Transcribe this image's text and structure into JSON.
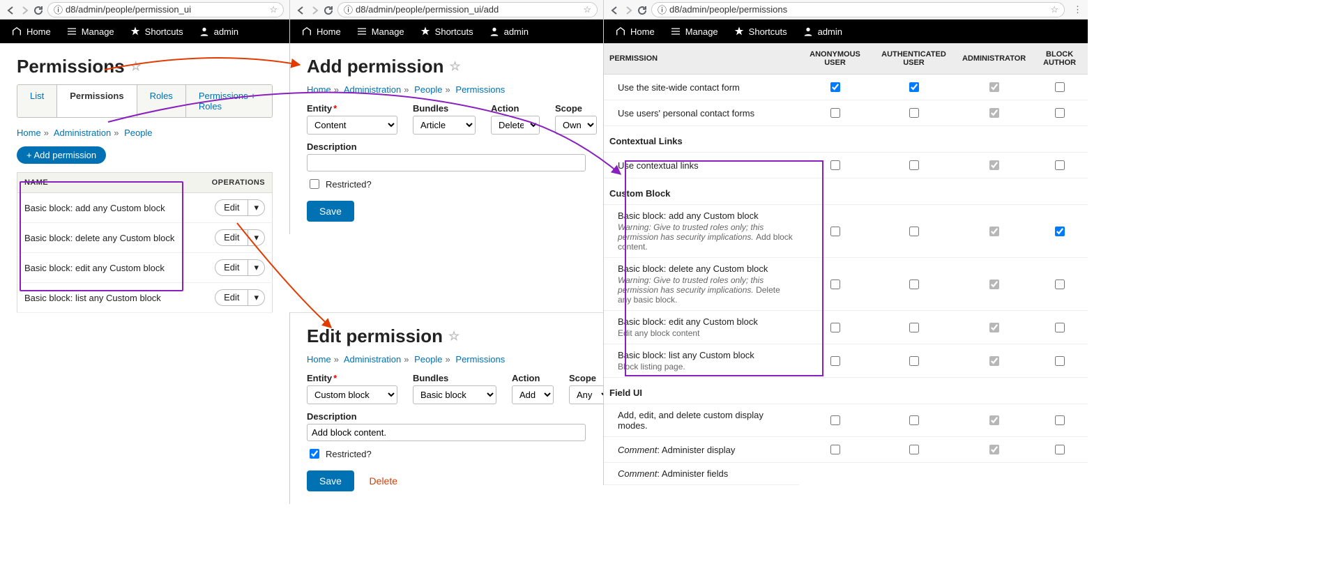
{
  "left": {
    "url": "d8/admin/people/permission_ui",
    "toolbar": {
      "home": "Home",
      "manage": "Manage",
      "shortcuts": "Shortcuts",
      "user": "admin"
    },
    "title": "Permissions",
    "tabs": [
      "List",
      "Permissions",
      "Roles",
      "Permissions + Roles"
    ],
    "active_tab": 1,
    "crumbs": [
      "Home",
      "Administration",
      "People"
    ],
    "add_btn": "+ Add permission",
    "cols": {
      "name": "Name",
      "ops": "Operations"
    },
    "rows": [
      "Basic block: add any Custom block",
      "Basic block: delete any Custom block",
      "Basic block: edit any Custom block",
      "Basic block: list any Custom block"
    ],
    "edit_label": "Edit"
  },
  "mid_upper": {
    "url": "d8/admin/people/permission_ui/add",
    "title": "Add permission",
    "crumbs": [
      "Home",
      "Administration",
      "People",
      "Permissions"
    ],
    "labels": {
      "entity": "Entity",
      "bundles": "Bundles",
      "action": "Action",
      "scope": "Scope",
      "desc": "Description",
      "restricted": "Restricted?"
    },
    "vals": {
      "entity": "Content",
      "bundles": "Article",
      "action": "Delete",
      "scope": "Own",
      "desc": ""
    },
    "restricted_checked": false,
    "save": "Save"
  },
  "mid_lower": {
    "title": "Edit permission",
    "crumbs": [
      "Home",
      "Administration",
      "People",
      "Permissions"
    ],
    "labels": {
      "entity": "Entity",
      "bundles": "Bundles",
      "action": "Action",
      "scope": "Scope",
      "desc": "Description",
      "restricted": "Restricted?"
    },
    "vals": {
      "entity": "Custom block",
      "bundles": "Basic block",
      "action": "Add",
      "scope": "Any",
      "desc": "Add block content."
    },
    "restricted_checked": true,
    "save": "Save",
    "delete": "Delete"
  },
  "right": {
    "url": "d8/admin/people/permissions",
    "toolbar": {
      "home": "Home",
      "manage": "Manage",
      "shortcuts": "Shortcuts",
      "user": "admin"
    },
    "cols": [
      "Permission",
      "Anonymous User",
      "Authenticated User",
      "Administrator",
      "Block Author"
    ],
    "rows": [
      {
        "type": "perm",
        "label": "Use the site-wide contact form",
        "cb": [
          "blue",
          "blue",
          "grey",
          "off"
        ]
      },
      {
        "type": "perm",
        "label": "Use users' personal contact forms",
        "cb": [
          "off",
          "off",
          "grey",
          "off"
        ]
      },
      {
        "type": "section",
        "label": "Contextual Links"
      },
      {
        "type": "perm",
        "label": "Use contextual links",
        "cb": [
          "off",
          "off",
          "grey",
          "off"
        ]
      },
      {
        "type": "section",
        "label": "Custom Block"
      },
      {
        "type": "perm",
        "label": "Basic block: add any Custom block",
        "sub": "Warning: Give to trusted roles only; this permission has security implications.",
        "tail": "Add block content.",
        "cb": [
          "off",
          "off",
          "grey",
          "blue"
        ]
      },
      {
        "type": "perm",
        "label": "Basic block: delete any Custom block",
        "sub": "Warning: Give to trusted roles only; this permission has security implications.",
        "tail": "Delete any basic block.",
        "cb": [
          "off",
          "off",
          "grey",
          "off"
        ]
      },
      {
        "type": "perm",
        "label": "Basic block: edit any Custom block",
        "tail": "Edit any block content",
        "cb": [
          "off",
          "off",
          "grey",
          "off"
        ]
      },
      {
        "type": "perm",
        "label": "Basic block: list any Custom block",
        "tail": "Block listing page.",
        "cb": [
          "off",
          "off",
          "grey",
          "off"
        ]
      },
      {
        "type": "section",
        "label": "Field UI"
      },
      {
        "type": "perm",
        "label": "Add, edit, and delete custom display modes.",
        "cb": [
          "off",
          "off",
          "grey",
          "off"
        ]
      },
      {
        "type": "perm",
        "label": "",
        "em": "Comment",
        "tail2": ": Administer display",
        "cb": [
          "off",
          "off",
          "grey",
          "off"
        ]
      },
      {
        "type": "perm",
        "label": "",
        "em": "Comment",
        "tail2": ": Administer fields"
      }
    ]
  }
}
